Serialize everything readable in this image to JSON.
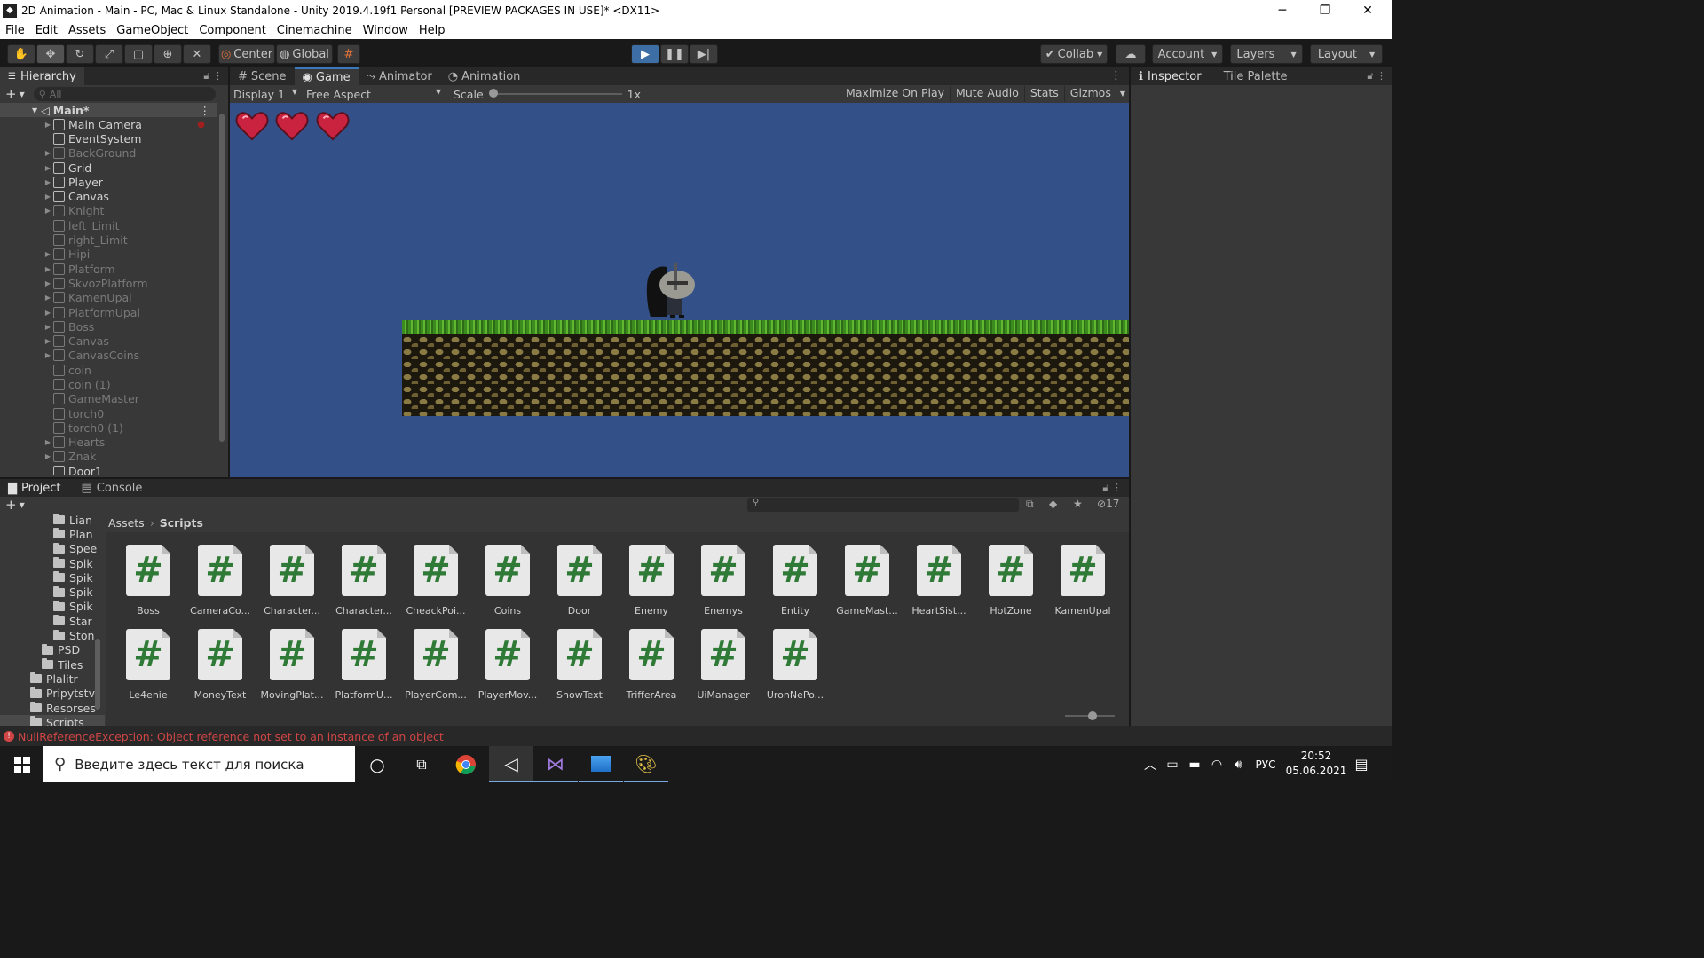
{
  "window": {
    "title": "2D Animation - Main - PC, Mac & Linux Standalone - Unity 2019.4.19f1 Personal [PREVIEW PACKAGES IN USE]* <DX11>",
    "minimize": "─",
    "maximize": "❐",
    "close": "✕"
  },
  "menu": [
    "File",
    "Edit",
    "Assets",
    "GameObject",
    "Component",
    "Cinemachine",
    "Window",
    "Help"
  ],
  "toolbar": {
    "center": "Center",
    "global": "Global",
    "collab": "Collab",
    "account": "Account",
    "layers": "Layers",
    "layout": "Layout"
  },
  "hierarchy": {
    "tab": "Hierarchy",
    "search_placeholder": "All",
    "scene": "Main*",
    "items": [
      {
        "name": "Main Camera",
        "dim": false,
        "expand": true
      },
      {
        "name": "EventSystem",
        "dim": false,
        "expand": false
      },
      {
        "name": "BackGround",
        "dim": true,
        "expand": true
      },
      {
        "name": "Grid",
        "dim": false,
        "expand": true
      },
      {
        "name": "Player",
        "dim": false,
        "expand": true
      },
      {
        "name": "Canvas",
        "dim": false,
        "expand": true
      },
      {
        "name": "Knight",
        "dim": true,
        "expand": true
      },
      {
        "name": "left_Limit",
        "dim": true,
        "expand": false
      },
      {
        "name": "right_Limit",
        "dim": true,
        "expand": false
      },
      {
        "name": "Hipi",
        "dim": true,
        "expand": true
      },
      {
        "name": "Platform",
        "dim": true,
        "expand": true
      },
      {
        "name": "SkvozPlatform",
        "dim": true,
        "expand": true
      },
      {
        "name": "KamenUpal",
        "dim": true,
        "expand": true
      },
      {
        "name": "PlatformUpal",
        "dim": true,
        "expand": true
      },
      {
        "name": "Boss",
        "dim": true,
        "expand": true
      },
      {
        "name": "Canvas",
        "dim": true,
        "expand": true
      },
      {
        "name": "CanvasCoins",
        "dim": true,
        "expand": true
      },
      {
        "name": "coin",
        "dim": true,
        "expand": false
      },
      {
        "name": "coin (1)",
        "dim": true,
        "expand": false
      },
      {
        "name": "GameMaster",
        "dim": true,
        "expand": false
      },
      {
        "name": "torch0",
        "dim": true,
        "expand": false
      },
      {
        "name": "torch0 (1)",
        "dim": true,
        "expand": false
      },
      {
        "name": "Hearts",
        "dim": true,
        "expand": true
      },
      {
        "name": "Znak",
        "dim": true,
        "expand": true
      },
      {
        "name": "Door1",
        "dim": false,
        "expand": false
      }
    ]
  },
  "center_tabs": {
    "scene": "Scene",
    "game": "Game",
    "animator": "Animator",
    "animation": "Animation"
  },
  "game_bar": {
    "display": "Display 1",
    "aspect": "Free Aspect",
    "scale_label": "Scale",
    "scale_value": "1x",
    "maximize": "Maximize On Play",
    "mute": "Mute Audio",
    "stats": "Stats",
    "gizmos": "Gizmos"
  },
  "right_tabs": {
    "inspector": "Inspector",
    "tile_palette": "Tile Palette"
  },
  "project": {
    "tab_project": "Project",
    "tab_console": "Console",
    "hidden_count": "17",
    "breadcrumb": [
      "Assets",
      "Scripts"
    ],
    "tree": [
      {
        "name": "Lian",
        "indent": 2
      },
      {
        "name": "Plan",
        "indent": 2
      },
      {
        "name": "Spee",
        "indent": 2
      },
      {
        "name": "Spik",
        "indent": 2
      },
      {
        "name": "Spik",
        "indent": 2
      },
      {
        "name": "Spik",
        "indent": 2
      },
      {
        "name": "Spik",
        "indent": 2
      },
      {
        "name": "Star",
        "indent": 2
      },
      {
        "name": "Ston",
        "indent": 2
      },
      {
        "name": "PSD",
        "indent": 1
      },
      {
        "name": "Tiles",
        "indent": 1
      },
      {
        "name": "Plalitr",
        "indent": 0
      },
      {
        "name": "Pripytstvi",
        "indent": 0
      },
      {
        "name": "Resorses",
        "indent": 0
      },
      {
        "name": "Scripts",
        "indent": 0
      }
    ],
    "assets": [
      "Boss",
      "CameraCo...",
      "Character...",
      "Character...",
      "CheackPoi...",
      "Coins",
      "Door",
      "Enemy",
      "Enemys",
      "Entity",
      "GameMast...",
      "HeartSist...",
      "HotZone",
      "KamenUpal",
      "Le4enie",
      "MoneyText",
      "MovingPlat...",
      "PlatformU...",
      "PlayerCom...",
      "PlayerMov...",
      "ShowText",
      "TrifferArea",
      "UiManager",
      "UronNePo..."
    ]
  },
  "status": {
    "error": "NullReferenceException: Object reference not set to an instance of an object"
  },
  "taskbar": {
    "search": "Введите здесь текст для поиска",
    "lang": "РУС",
    "time": "20:52",
    "date": "05.06.2021"
  },
  "colors": {
    "accent": "#3a79bb",
    "error": "#d04545",
    "sky": "#335088"
  }
}
